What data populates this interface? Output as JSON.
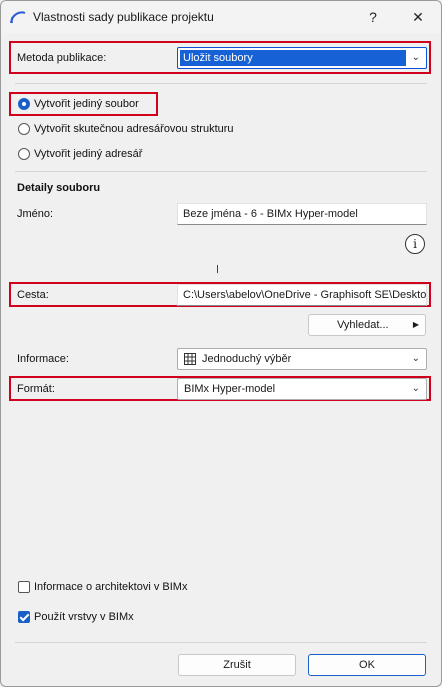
{
  "window": {
    "title": "Vlastnosti sady publikace projektu",
    "help_glyph": "?",
    "close_glyph": "✕"
  },
  "publish_method": {
    "label": "Metoda publikace:",
    "value": "Uložit soubory"
  },
  "options": [
    {
      "label": "Vytvořit jediný soubor",
      "checked": true
    },
    {
      "label": "Vytvořit skutečnou adresářovou strukturu",
      "checked": false
    },
    {
      "label": "Vytvořit jediný adresář",
      "checked": false
    }
  ],
  "details": {
    "heading": "Detaily souboru",
    "name_label": "Jméno:",
    "name_value": "Beze jména - 6 - BIMx Hyper-model",
    "info_glyph": "i",
    "path_label": "Cesta:",
    "path_value": "C:\\Users\\abelov\\OneDrive - Graphisoft SE\\Desktop",
    "browse_label": "Vyhledat...",
    "info_label": "Informace:",
    "info_value": "Jednoduchý výběr",
    "format_label": "Formát:",
    "format_value": "BIMx Hyper-model"
  },
  "checkboxes": [
    {
      "label": "Informace o architektovi v BIMx",
      "checked": false
    },
    {
      "label": "Použít vrstvy v BIMx",
      "checked": true
    }
  ],
  "buttons": {
    "cancel": "Zrušit",
    "ok": "OK"
  },
  "colors": {
    "highlight_box": "#d0021b",
    "accent": "#1a5fc8"
  }
}
